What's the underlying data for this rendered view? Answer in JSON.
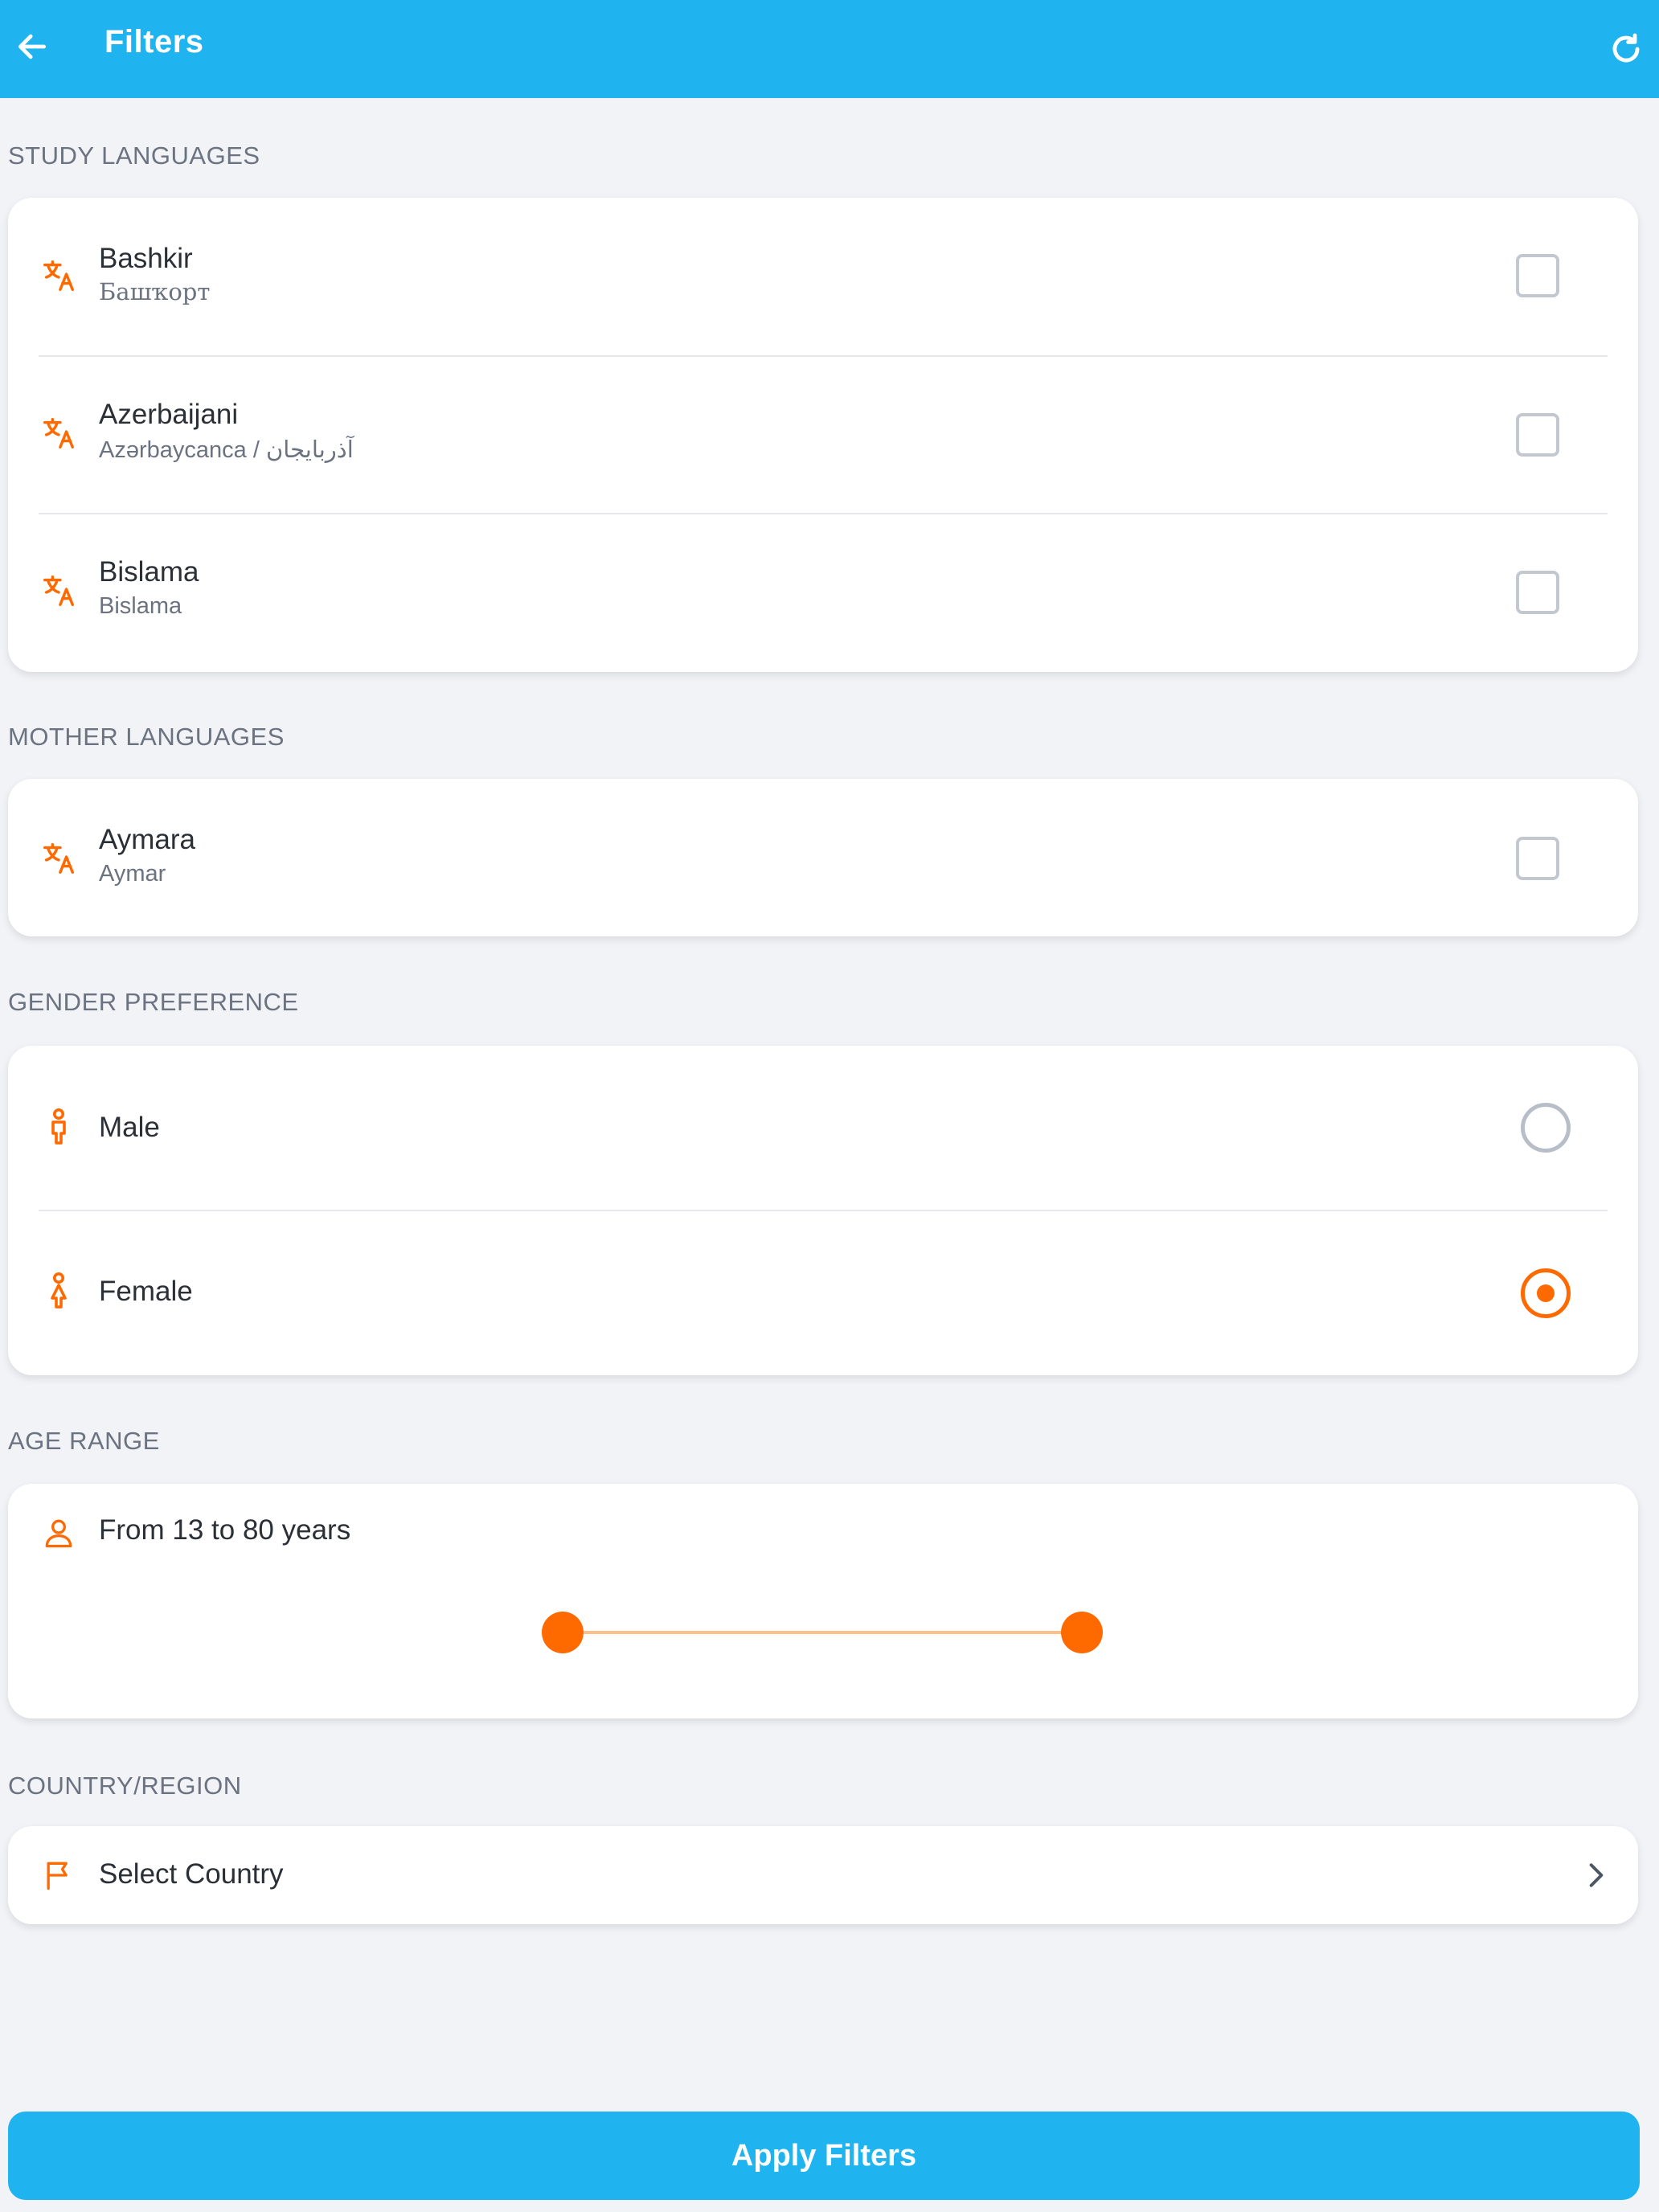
{
  "appbar": {
    "title": "Filters",
    "back_icon": "arrow-left-icon",
    "reset_icon": "refresh-icon"
  },
  "colors": {
    "primary": "#1fb3ef",
    "accent": "#ff6a00",
    "background": "#f2f3f7"
  },
  "study_languages": {
    "label": "STUDY LANGUAGES",
    "items": [
      {
        "name": "Bashkir",
        "native": "Башҡорт",
        "checked": false
      },
      {
        "name": "Azerbaijani",
        "native": "Azərbaycanca / آذربایجان",
        "checked": false
      },
      {
        "name": "Bislama",
        "native": "Bislama",
        "checked": false
      }
    ]
  },
  "mother_languages": {
    "label": "MOTHER LANGUAGES",
    "items": [
      {
        "name": "Aymara",
        "native": "Aymar",
        "checked": false
      }
    ]
  },
  "gender": {
    "label": "GENDER PREFERENCE",
    "options": [
      {
        "label": "Male",
        "selected": false
      },
      {
        "label": "Female",
        "selected": true
      }
    ]
  },
  "age": {
    "label": "AGE RANGE",
    "text": "From 13 to 80 years",
    "min": 13,
    "max": 80
  },
  "country": {
    "label": "COUNTRY/REGION",
    "placeholder": "Select Country"
  },
  "apply_label": "Apply Filters"
}
